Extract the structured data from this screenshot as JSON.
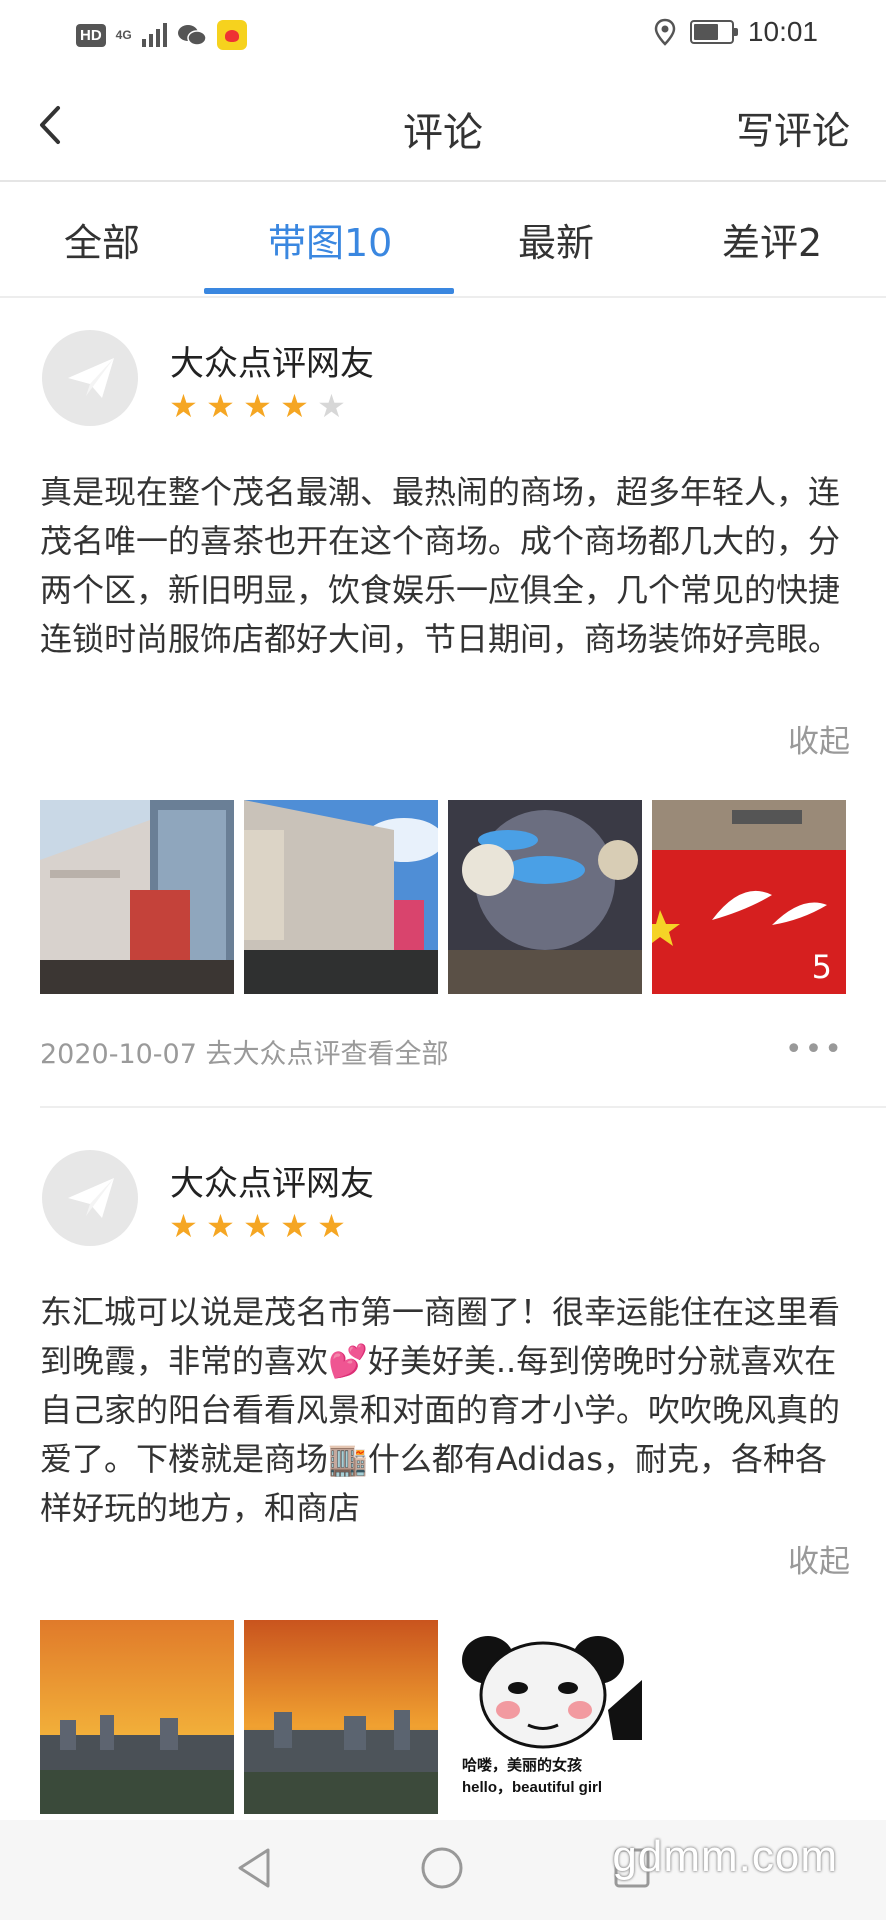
{
  "status_bar": {
    "hd": "HD",
    "network": "4G",
    "time": "10:01"
  },
  "header": {
    "title": "评论",
    "write_label": "写评论"
  },
  "tabs": [
    {
      "label": "全部",
      "active": false
    },
    {
      "label": "带图10",
      "active": true
    },
    {
      "label": "最新",
      "active": false
    },
    {
      "label": "差评2",
      "active": false
    }
  ],
  "colors": {
    "accent": "#3a87e0",
    "star": "#f5a623",
    "star_empty": "#d7d7d7"
  },
  "reviews": [
    {
      "user": "大众点评网友",
      "rating": 4,
      "text": "真是现在整个茂名最潮、最热闹的商场，超多年轻人，连茂名唯一的喜茶也开在这个商场。成个商场都几大的，分两个区，新旧明显，饮食娱乐一应俱全，几个常见的快捷连锁时尚服饰店都好大间，节日期间，商场装饰好亮眼。",
      "collapse_label": "收起",
      "photo_count_badge": "5",
      "date": "2020-10-07",
      "source_link": "去大众点评查看全部",
      "more": "•••"
    },
    {
      "user": "大众点评网友",
      "rating": 5,
      "text": "东汇城可以说是茂名市第一商圈了！很幸运能住在这里看到晚霞，非常的喜欢💕好美好美..每到傍晚时分就喜欢在自己家的阳台看看风景和对面的育才小学。吹吹晚风真的爱了。下楼就是商场🏬什么都有Adidas，耐克，各种各样好玩的地方，和商店",
      "collapse_label": "收起",
      "meme_caption_1": "哈喽，美丽的女孩",
      "meme_caption_2": "hello，beautiful girl"
    }
  ],
  "watermark": "gdmm.com"
}
